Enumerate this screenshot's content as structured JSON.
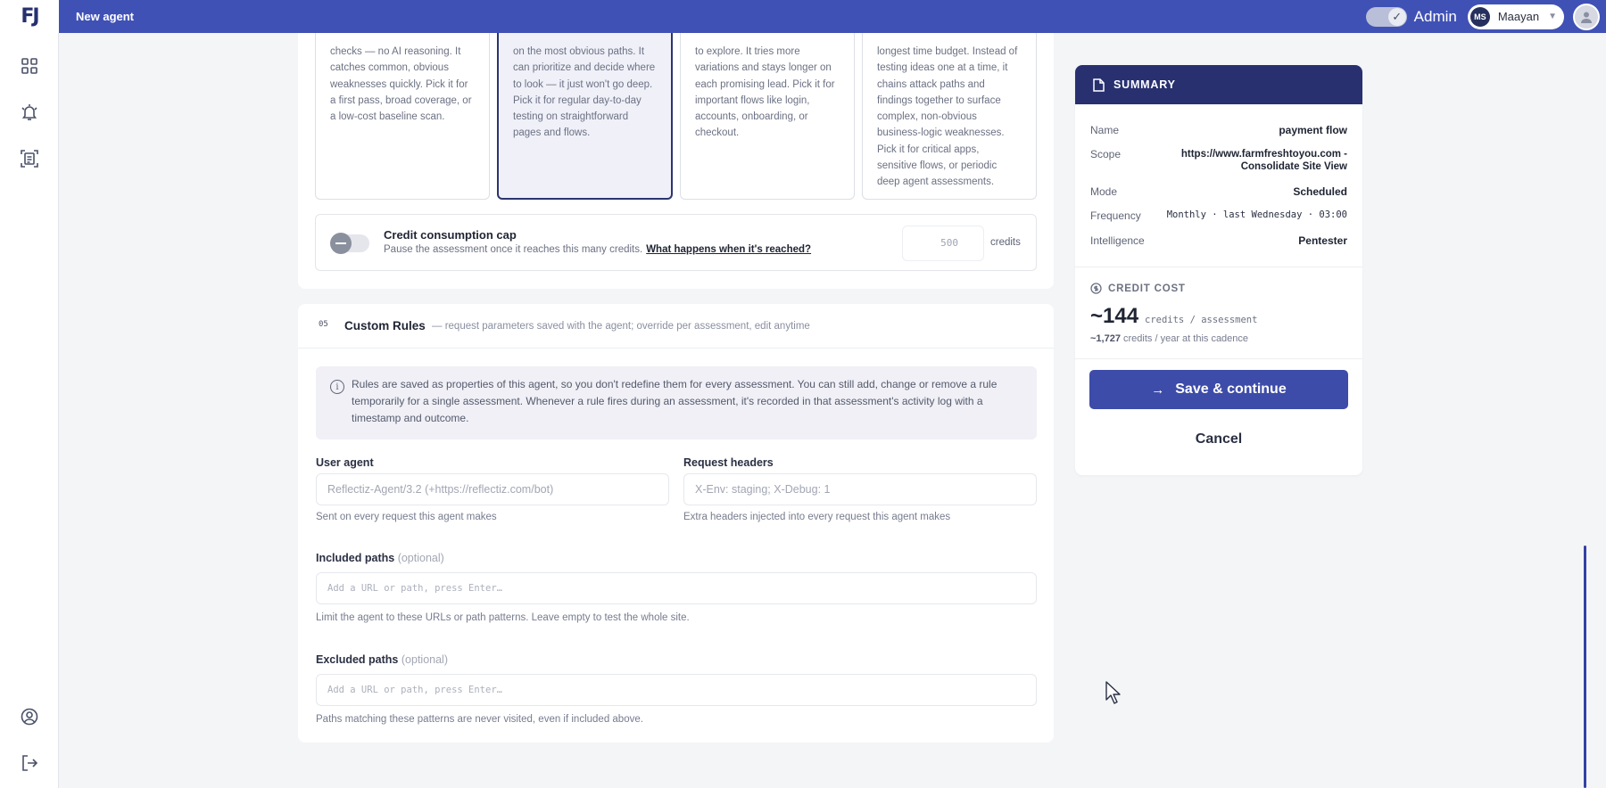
{
  "app": {
    "logo_text": "FJ",
    "page_title": "New agent"
  },
  "topbar": {
    "admin_label": "Admin",
    "user_initials": "MS",
    "user_name": "Maayan"
  },
  "sidebar": {
    "items": [
      {
        "name": "dashboard",
        "icon": "grid-icon"
      },
      {
        "name": "alerts",
        "icon": "bell-alert-icon"
      },
      {
        "name": "reports",
        "icon": "scan-document-icon"
      },
      {
        "name": "account",
        "icon": "user-circle-icon"
      },
      {
        "name": "logout",
        "icon": "logout-icon"
      }
    ]
  },
  "intelligence_options": [
    {
      "text": "checks — no AI reasoning. It catches common, obvious weaknesses quickly. Pick it for a first pass, broad coverage, or a low-cost baseline scan.",
      "selected": false
    },
    {
      "text": "on the most obvious paths. It can prioritize and decide where to look — it just won't go deep. Pick it for regular day-to-day testing on straightforward pages and flows.",
      "selected": true
    },
    {
      "text": "to explore. It tries more variations and stays longer on each promising lead. Pick it for important flows like login, accounts, onboarding, or checkout.",
      "selected": false
    },
    {
      "text": "longest time budget. Instead of testing ideas one at a time, it chains attack paths and findings together to surface complex, non-obvious business-logic weaknesses. Pick it for critical apps, sensitive flows, or periodic deep agent assessments.",
      "selected": false
    }
  ],
  "credit_cap": {
    "title": "Credit consumption cap",
    "description": "Pause the assessment once it reaches this many credits.",
    "link": "What happens when it's reached?",
    "placeholder": "500",
    "unit": "credits",
    "enabled": false
  },
  "custom_rules": {
    "number": "05",
    "title": "Custom Rules",
    "subtitle": "— request parameters saved with the agent; override per assessment, edit anytime",
    "info": "Rules are saved as properties of this agent, so you don't redefine them for every assessment. You can still add, change or remove a rule temporarily for a single assessment. Whenever a rule fires during an assessment, it's recorded in that assessment's activity log with a timestamp and outcome.",
    "user_agent": {
      "label": "User agent",
      "placeholder": "Reflectiz-Agent/3.2 (+https://reflectiz.com/bot)",
      "help": "Sent on every request this agent makes"
    },
    "request_headers": {
      "label": "Request headers",
      "placeholder": "X-Env: staging; X-Debug: 1",
      "help": "Extra headers injected into every request this agent makes"
    },
    "included_paths": {
      "label": "Included paths",
      "optional": "(optional)",
      "placeholder": "Add a URL or path, press Enter…",
      "help": "Limit the agent to these URLs or path patterns. Leave empty to test the whole site."
    },
    "excluded_paths": {
      "label": "Excluded paths",
      "optional": "(optional)",
      "placeholder": "Add a URL or path, press Enter…",
      "help": "Paths matching these patterns are never visited, even if included above."
    }
  },
  "summary": {
    "title": "SUMMARY",
    "rows": [
      {
        "key": "Name",
        "value": "payment flow"
      },
      {
        "key": "Scope",
        "value": "https://www.farmfreshtoyou.com - Consolidate Site View"
      },
      {
        "key": "Mode",
        "value": "Scheduled"
      },
      {
        "key": "Frequency",
        "value": "Monthly · last Wednesday · 03:00"
      },
      {
        "key": "Intelligence",
        "value": "Pentester"
      }
    ],
    "cost_label": "CREDIT COST",
    "cost_value": "~144",
    "cost_unit": "credits / assessment",
    "yearly_value": "~1,727",
    "yearly_text": "credits / year at this cadence",
    "save_label": "Save & continue",
    "cancel_label": "Cancel"
  },
  "colors": {
    "primary": "#4051b5",
    "navy": "#283070",
    "button": "#3d4ca8"
  }
}
